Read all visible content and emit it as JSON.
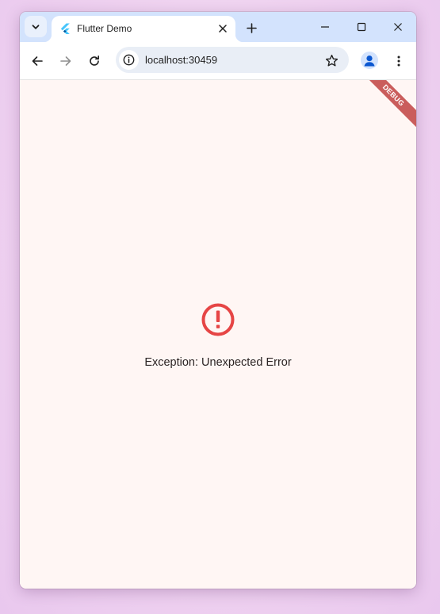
{
  "tab": {
    "title": "Flutter Demo"
  },
  "toolbar": {
    "url": "localhost:30459"
  },
  "content": {
    "debug_banner": "DEBUG",
    "error_message": "Exception: Unexpected Error"
  },
  "icons": {
    "tab_search": "chevron-down-icon",
    "favicon": "flutter-logo-icon",
    "tab_close": "close-icon",
    "new_tab": "plus-icon",
    "minimize": "minimize-icon",
    "maximize": "maximize-icon",
    "close_window": "close-icon",
    "back": "arrow-left-icon",
    "forward": "arrow-right-icon",
    "reload": "reload-icon",
    "site_info": "info-icon",
    "bookmark": "star-outline-icon",
    "profile": "person-icon",
    "menu": "more-vertical-icon",
    "error": "error-outline-icon"
  },
  "colors": {
    "tabstrip_bg": "#d3e3fd",
    "content_bg": "#fff6f4",
    "error_red": "#e64545",
    "debug_banner": "#b82a2a",
    "profile_blue": "#0b57d0"
  }
}
